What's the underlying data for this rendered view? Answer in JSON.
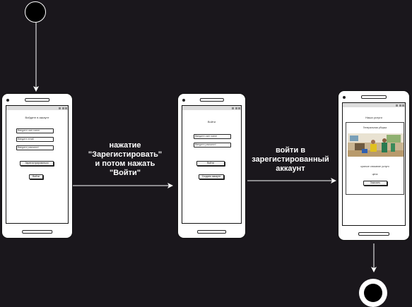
{
  "initial_node": {
    "name": "start"
  },
  "final_node": {
    "name": "end"
  },
  "transitions": {
    "register_then_login": "нажатие \"Зарегистировать\"\nи потом нажать\n\"Войти\"",
    "login_to_account": "войти в\nзарегистированный\nаккаунт"
  },
  "screens": {
    "register": {
      "title": "Войдите в аккаунт",
      "fields": [
        "Введите user name",
        "Введите email",
        "Введите password"
      ],
      "register_button": "Зарегистрироваться",
      "login_button": "Войти"
    },
    "login": {
      "title": "Войти",
      "fields": [
        "Введите user name",
        "Введите password"
      ],
      "login_button": "Войти",
      "create_button": "Создать аккаунт"
    },
    "services": {
      "title": "Наши услуги",
      "service_name": "Генеральная уборка",
      "description": "краткое описание услуги",
      "price": "цена",
      "order_button": "Заказать"
    }
  },
  "colors": {
    "background": "#1a171c",
    "lines": "#ffffff",
    "phone": "#ffffff"
  }
}
